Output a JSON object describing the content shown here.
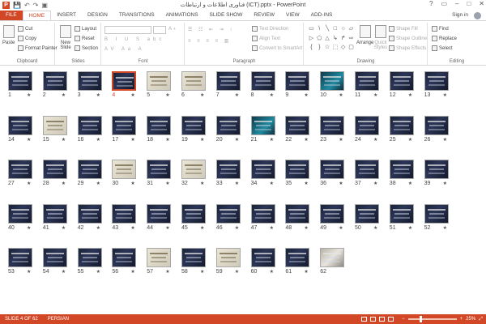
{
  "window": {
    "title": "فناوری اطلاعات و ارتباطات (ICT).pptx - PowerPoint",
    "app_icon_letter": "P",
    "controls": [
      "?",
      "▭",
      "–",
      "□",
      "✕"
    ]
  },
  "qat": {
    "save": "💾",
    "undo": "↶",
    "redo": "↷",
    "present": "▣"
  },
  "tabs": [
    {
      "label": "FILE",
      "kind": "file"
    },
    {
      "label": "HOME",
      "kind": "active"
    },
    {
      "label": "INSERT",
      "kind": ""
    },
    {
      "label": "DESIGN",
      "kind": ""
    },
    {
      "label": "TRANSITIONS",
      "kind": ""
    },
    {
      "label": "ANIMATIONS",
      "kind": ""
    },
    {
      "label": "SLIDE SHOW",
      "kind": ""
    },
    {
      "label": "REVIEW",
      "kind": ""
    },
    {
      "label": "VIEW",
      "kind": ""
    },
    {
      "label": "ADD-INS",
      "kind": ""
    }
  ],
  "account": {
    "sign_in": "Sign in"
  },
  "ribbon": {
    "clipboard": {
      "label": "Clipboard",
      "paste": "Paste",
      "cut": "Cut",
      "copy": "Copy",
      "format_painter": "Format Painter"
    },
    "slides": {
      "label": "Slides",
      "new_slide": "New Slide",
      "layout": "Layout",
      "reset": "Reset",
      "section": "Section"
    },
    "font": {
      "label": "Font"
    },
    "paragraph": {
      "label": "Paragraph",
      "text_direction": "Text Direction",
      "align_text": "Align Text",
      "convert_smartart": "Convert to SmartArt"
    },
    "drawing": {
      "label": "Drawing",
      "arrange": "Arrange",
      "quick_styles": "Quick Styles",
      "shape_fill": "Shape Fill",
      "shape_outline": "Shape Outline",
      "shape_effects": "Shape Effects",
      "shapes": [
        "▭",
        "\\",
        "╲",
        "□",
        "○",
        "▱",
        "▷",
        "⬠",
        "△",
        "↳",
        "↱",
        "⇨",
        "{",
        "}",
        "☆",
        "⬚",
        "◇",
        "▢"
      ]
    },
    "editing": {
      "label": "Editing",
      "find": "Find",
      "replace": "Replace",
      "select": "Select"
    }
  },
  "slides": [
    {
      "n": "1",
      "star": "★",
      "style": ""
    },
    {
      "n": "2",
      "star": "★",
      "style": ""
    },
    {
      "n": "3",
      "star": "★",
      "style": ""
    },
    {
      "n": "4",
      "star": "★",
      "style": ""
    },
    {
      "n": "5",
      "star": "★",
      "style": "light"
    },
    {
      "n": "6",
      "star": "★",
      "style": "light"
    },
    {
      "n": "7",
      "star": "★",
      "style": ""
    },
    {
      "n": "8",
      "star": "★",
      "style": ""
    },
    {
      "n": "9",
      "star": "★",
      "style": ""
    },
    {
      "n": "10",
      "star": "★",
      "style": "teal"
    },
    {
      "n": "11",
      "star": "★",
      "style": ""
    },
    {
      "n": "12",
      "star": "★",
      "style": ""
    },
    {
      "n": "13",
      "star": "★",
      "style": ""
    },
    {
      "n": "14",
      "star": "★",
      "style": ""
    },
    {
      "n": "15",
      "star": "★",
      "style": "light"
    },
    {
      "n": "16",
      "star": "★",
      "style": ""
    },
    {
      "n": "17",
      "star": "★",
      "style": ""
    },
    {
      "n": "18",
      "star": "★",
      "style": ""
    },
    {
      "n": "19",
      "star": "★",
      "style": ""
    },
    {
      "n": "20",
      "star": "★",
      "style": ""
    },
    {
      "n": "21",
      "star": "★",
      "style": "teal"
    },
    {
      "n": "22",
      "star": "★",
      "style": ""
    },
    {
      "n": "23",
      "star": "★",
      "style": ""
    },
    {
      "n": "24",
      "star": "★",
      "style": ""
    },
    {
      "n": "25",
      "star": "★",
      "style": ""
    },
    {
      "n": "26",
      "star": "★",
      "style": ""
    },
    {
      "n": "27",
      "star": "★",
      "style": ""
    },
    {
      "n": "28",
      "star": "★",
      "style": ""
    },
    {
      "n": "29",
      "star": "★",
      "style": ""
    },
    {
      "n": "30",
      "star": "★",
      "style": "light"
    },
    {
      "n": "31",
      "star": "★",
      "style": ""
    },
    {
      "n": "32",
      "star": "★",
      "style": "light"
    },
    {
      "n": "33",
      "star": "★",
      "style": ""
    },
    {
      "n": "34",
      "star": "★",
      "style": ""
    },
    {
      "n": "35",
      "star": "★",
      "style": ""
    },
    {
      "n": "36",
      "star": "★",
      "style": ""
    },
    {
      "n": "37",
      "star": "★",
      "style": ""
    },
    {
      "n": "38",
      "star": "★",
      "style": ""
    },
    {
      "n": "39",
      "star": "★",
      "style": ""
    },
    {
      "n": "40",
      "star": "★",
      "style": ""
    },
    {
      "n": "41",
      "star": "★",
      "style": ""
    },
    {
      "n": "42",
      "star": "★",
      "style": ""
    },
    {
      "n": "43",
      "star": "★",
      "style": ""
    },
    {
      "n": "44",
      "star": "★",
      "style": ""
    },
    {
      "n": "45",
      "star": "★",
      "style": ""
    },
    {
      "n": "46",
      "star": "★",
      "style": ""
    },
    {
      "n": "47",
      "star": "★",
      "style": ""
    },
    {
      "n": "48",
      "star": "★",
      "style": ""
    },
    {
      "n": "49",
      "star": "★",
      "style": ""
    },
    {
      "n": "50",
      "star": "★",
      "style": ""
    },
    {
      "n": "51",
      "star": "★",
      "style": ""
    },
    {
      "n": "52",
      "star": "★",
      "style": ""
    },
    {
      "n": "53",
      "star": "★",
      "style": ""
    },
    {
      "n": "54",
      "star": "★",
      "style": ""
    },
    {
      "n": "55",
      "star": "★",
      "style": ""
    },
    {
      "n": "56",
      "star": "★",
      "style": ""
    },
    {
      "n": "57",
      "star": "★",
      "style": "light"
    },
    {
      "n": "58",
      "star": "★",
      "style": ""
    },
    {
      "n": "59",
      "star": "★",
      "style": "light"
    },
    {
      "n": "60",
      "star": "★",
      "style": ""
    },
    {
      "n": "61",
      "star": "★",
      "style": ""
    },
    {
      "n": "62",
      "star": "",
      "style": "photo"
    }
  ],
  "selected_slide": "4",
  "status": {
    "slide_info": "SLIDE 4 OF 62",
    "language": "PERSIAN",
    "zoom_minus": "−",
    "zoom_plus": "+",
    "zoom": "25%",
    "zoom_fraction": 0.25
  },
  "colors": {
    "accent": "#d24726",
    "thumb_dark": "#1a2238"
  }
}
